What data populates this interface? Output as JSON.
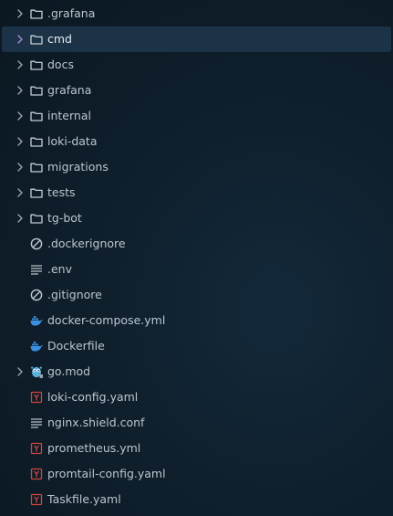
{
  "explorer": {
    "items": [
      {
        "label": ".grafana",
        "kind": "folder",
        "name": "folder-grafana-hidden",
        "expandable": true,
        "selected": false
      },
      {
        "label": "cmd",
        "kind": "folder",
        "name": "folder-cmd",
        "expandable": true,
        "selected": true
      },
      {
        "label": "docs",
        "kind": "folder",
        "name": "folder-docs",
        "expandable": true,
        "selected": false
      },
      {
        "label": "grafana",
        "kind": "folder",
        "name": "folder-grafana",
        "expandable": true,
        "selected": false
      },
      {
        "label": "internal",
        "kind": "folder",
        "name": "folder-internal",
        "expandable": true,
        "selected": false
      },
      {
        "label": "loki-data",
        "kind": "folder",
        "name": "folder-loki-data",
        "expandable": true,
        "selected": false
      },
      {
        "label": "migrations",
        "kind": "folder",
        "name": "folder-migrations",
        "expandable": true,
        "selected": false
      },
      {
        "label": "tests",
        "kind": "folder",
        "name": "folder-tests",
        "expandable": true,
        "selected": false
      },
      {
        "label": "tg-bot",
        "kind": "folder",
        "name": "folder-tg-bot",
        "expandable": true,
        "selected": false
      },
      {
        "label": ".dockerignore",
        "kind": "ignore",
        "name": "file-dockerignore",
        "expandable": false,
        "selected": false
      },
      {
        "label": ".env",
        "kind": "text",
        "name": "file-env",
        "expandable": false,
        "selected": false
      },
      {
        "label": ".gitignore",
        "kind": "ignore",
        "name": "file-gitignore",
        "expandable": false,
        "selected": false
      },
      {
        "label": "docker-compose.yml",
        "kind": "docker",
        "name": "file-docker-compose",
        "expandable": false,
        "selected": false
      },
      {
        "label": "Dockerfile",
        "kind": "docker",
        "name": "file-dockerfile",
        "expandable": false,
        "selected": false
      },
      {
        "label": "go.mod",
        "kind": "gomod",
        "name": "file-go-mod",
        "expandable": true,
        "selected": false
      },
      {
        "label": "loki-config.yaml",
        "kind": "yaml",
        "name": "file-loki-config",
        "expandable": false,
        "selected": false
      },
      {
        "label": "nginx.shield.conf",
        "kind": "text",
        "name": "file-nginx-shield-conf",
        "expandable": false,
        "selected": false
      },
      {
        "label": "prometheus.yml",
        "kind": "yaml",
        "name": "file-prometheus",
        "expandable": false,
        "selected": false
      },
      {
        "label": "promtail-config.yaml",
        "kind": "yaml",
        "name": "file-promtail-config",
        "expandable": false,
        "selected": false
      },
      {
        "label": "Taskfile.yaml",
        "kind": "yaml",
        "name": "file-taskfile",
        "expandable": false,
        "selected": false
      }
    ]
  },
  "icons": {
    "chevron": "chevron-right-icon",
    "folder": "folder-icon",
    "ignore": "ignore-file-icon",
    "text": "text-file-icon",
    "docker": "docker-icon",
    "gomod": "go-mod-icon",
    "yaml": "yaml-icon"
  },
  "colors": {
    "background": "#0f1f2c",
    "selected_row": "#1c3347",
    "text": "#bcc6d0",
    "folder_icon": "#c5cdd5",
    "docker_blue": "#3a8fe0",
    "yaml_red": "#d0453d",
    "go_blue": "#5ab0d8",
    "chevron_selected": "#a888d8"
  }
}
